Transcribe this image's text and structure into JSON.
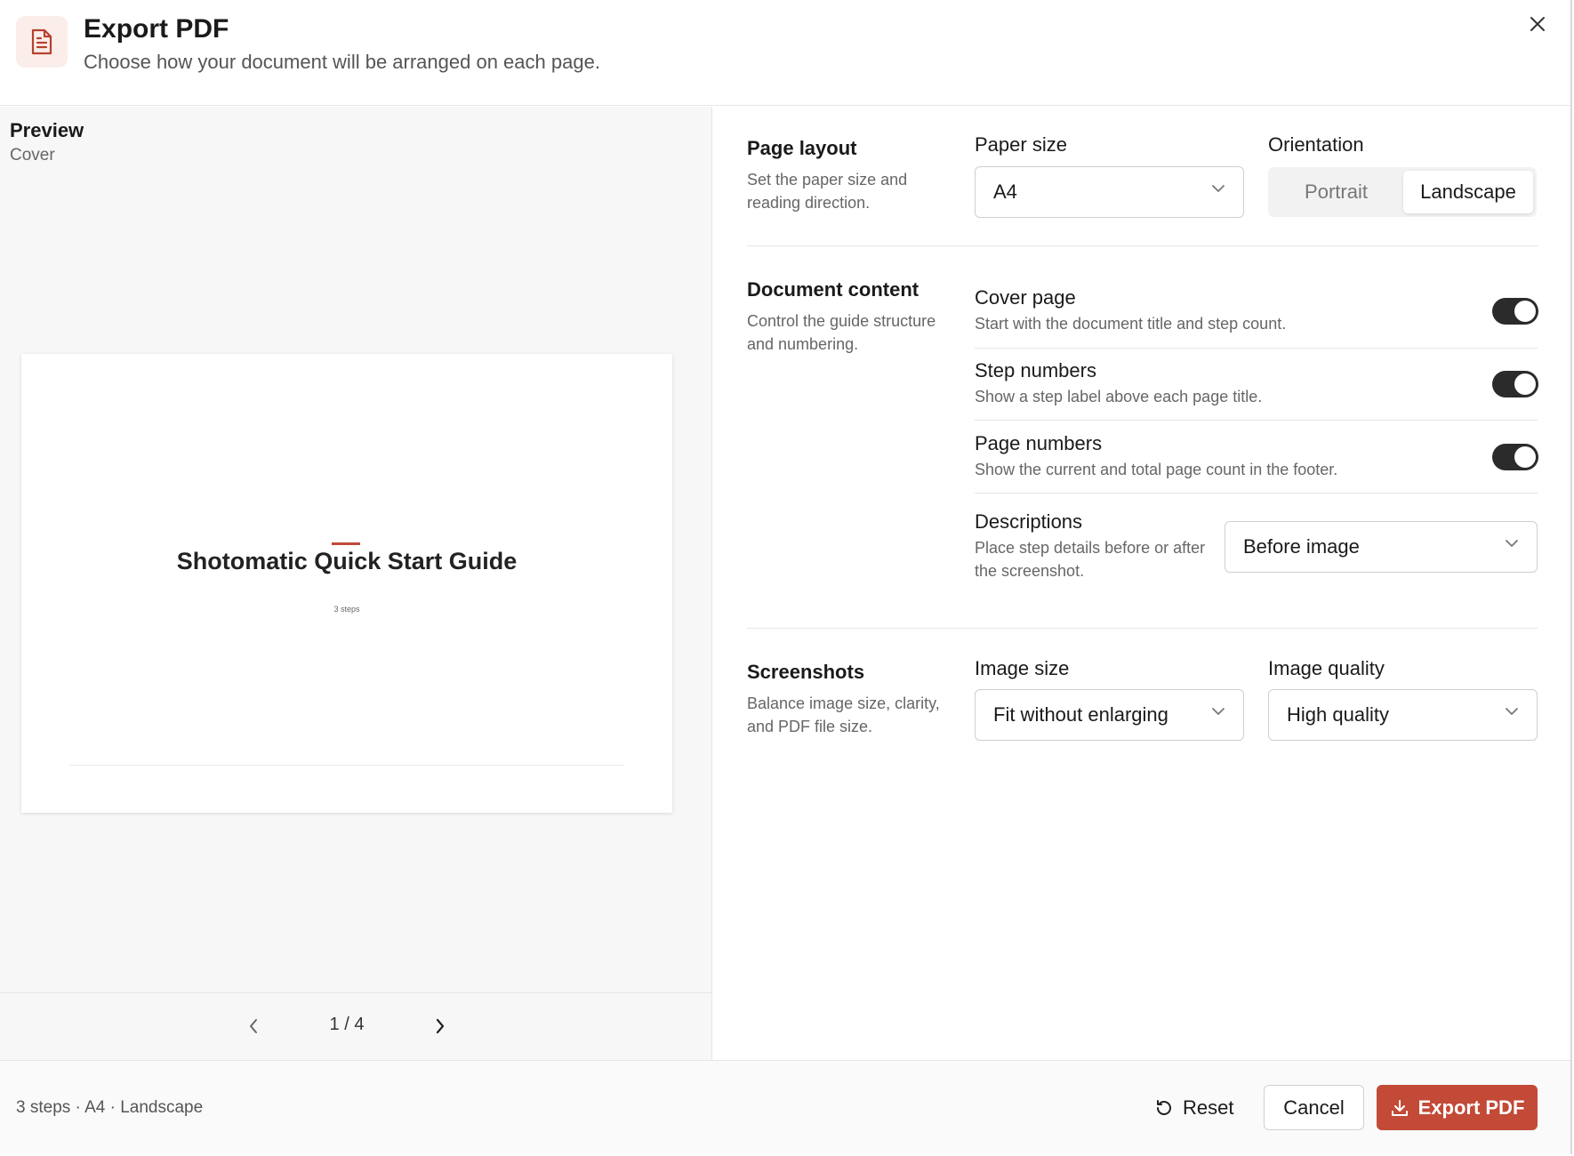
{
  "dialog": {
    "title": "Export PDF",
    "subtitle": "Choose how your document will be arranged on each page."
  },
  "preview": {
    "title": "Preview",
    "page_type": "Cover",
    "sheet_title": "Shotomatic Quick Start Guide",
    "sheet_steps": "3 steps",
    "pager": "1 / 4",
    "accent_color": "#c0493a"
  },
  "page_layout": {
    "title": "Page layout",
    "description": "Set the paper size and reading direction.",
    "paper_size_label": "Paper size",
    "paper_size_value": "A4",
    "orientation_label": "Orientation",
    "orientation_options": [
      "Portrait",
      "Landscape"
    ],
    "orientation_selected": "Landscape"
  },
  "document_content": {
    "title": "Document content",
    "description": "Control the guide structure and numbering.",
    "options": [
      {
        "title": "Cover page",
        "desc": "Start with the document title and step count.",
        "enabled": true
      },
      {
        "title": "Step numbers",
        "desc": "Show a step label above each page title.",
        "enabled": true
      },
      {
        "title": "Page numbers",
        "desc": "Show the current and total page count in the footer.",
        "enabled": true
      }
    ],
    "descriptions_label": "Descriptions",
    "descriptions_desc": "Place step details before or after the screenshot.",
    "descriptions_value": "Before image"
  },
  "screenshots": {
    "title": "Screenshots",
    "description": "Balance image size, clarity, and PDF file size.",
    "image_size_label": "Image size",
    "image_size_value": "Fit without enlarging",
    "image_quality_label": "Image quality",
    "image_quality_value": "High quality"
  },
  "footer": {
    "summary": "3 steps · A4 · Landscape",
    "reset_label": "Reset",
    "cancel_label": "Cancel",
    "export_label": "Export PDF",
    "export_color": "#c24a37"
  }
}
